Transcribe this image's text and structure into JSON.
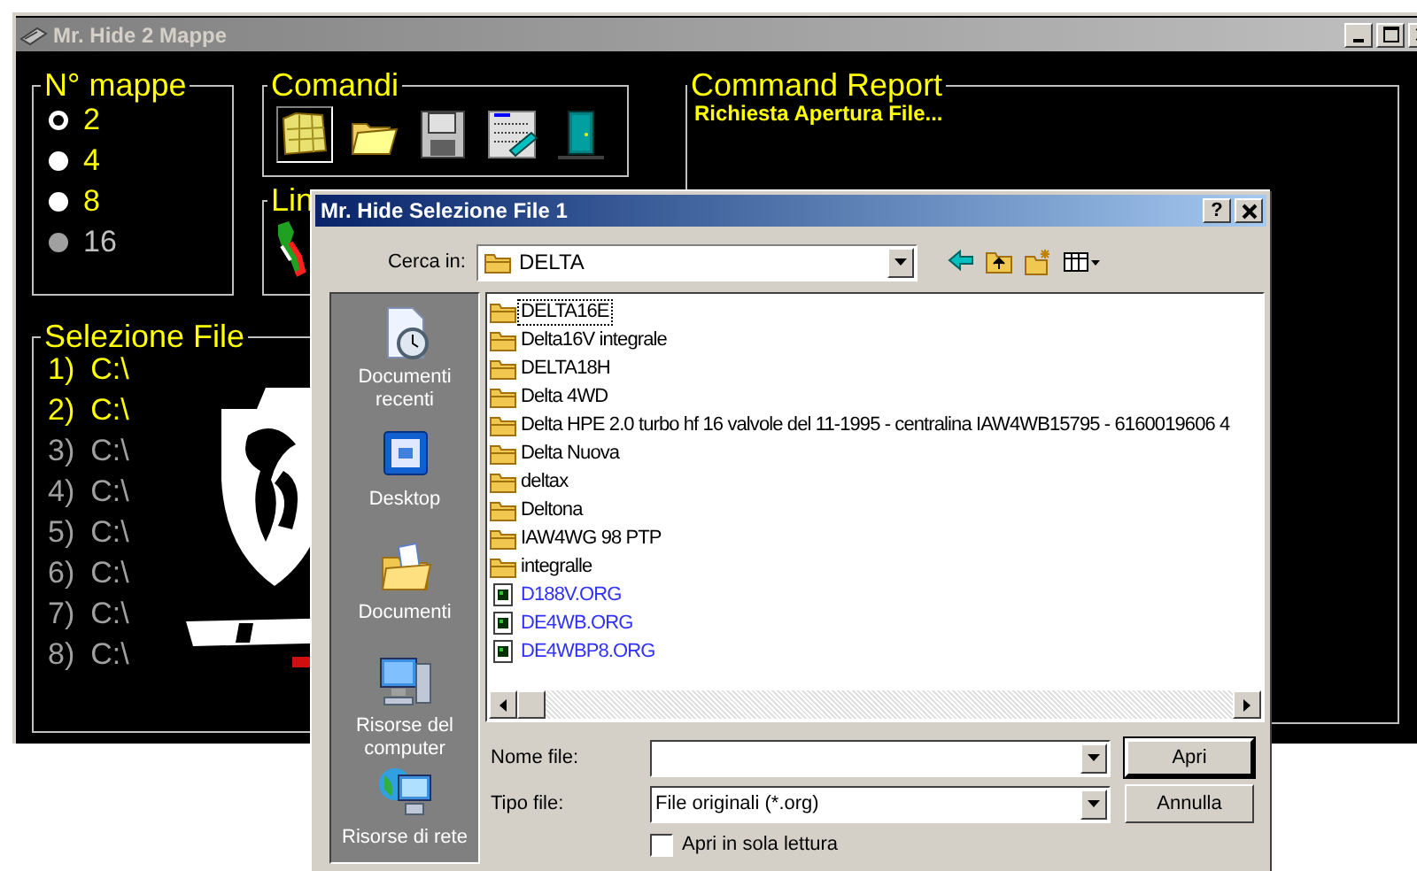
{
  "window": {
    "title": "Mr. Hide 2 Mappe",
    "active": false
  },
  "map_count": {
    "title": "N° mappe",
    "options": [
      {
        "label": "2",
        "selected": true,
        "disabled": false
      },
      {
        "label": "4",
        "selected": false,
        "disabled": false
      },
      {
        "label": "8",
        "selected": false,
        "disabled": false
      },
      {
        "label": "16",
        "selected": false,
        "disabled": true
      }
    ]
  },
  "commands": {
    "title": "Comandi",
    "buttons": [
      {
        "kind": "map",
        "pressed": true
      },
      {
        "kind": "open",
        "pressed": false
      },
      {
        "kind": "disk",
        "pressed": false
      },
      {
        "kind": "write",
        "pressed": false
      },
      {
        "kind": "exit",
        "pressed": false
      }
    ]
  },
  "lin_group": {
    "title": "Lin"
  },
  "command_report": {
    "title": "Command Report",
    "lines": [
      "Richiesta Apertura File..."
    ]
  },
  "file_selection": {
    "title": "Selezione File",
    "files": [
      {
        "number": "1)",
        "path": "C:\\",
        "enabled": true
      },
      {
        "number": "2)",
        "path": "C:\\",
        "enabled": true
      },
      {
        "number": "3)",
        "path": "C:\\",
        "enabled": false
      },
      {
        "number": "4)",
        "path": "C:\\",
        "enabled": false
      },
      {
        "number": "5)",
        "path": "C:\\",
        "enabled": false
      },
      {
        "number": "6)",
        "path": "C:\\",
        "enabled": false
      },
      {
        "number": "7)",
        "path": "C:\\",
        "enabled": false
      },
      {
        "number": "8)",
        "path": "C:\\",
        "enabled": false
      }
    ]
  },
  "dialog": {
    "title": "Mr. Hide Selezione File 1",
    "help_button": "?",
    "look_in": {
      "label": "Cerca in:",
      "value": "DELTA"
    },
    "places": [
      {
        "kind": "recent",
        "label": "Documenti recenti"
      },
      {
        "kind": "desktop",
        "label": "Desktop"
      },
      {
        "kind": "documents",
        "label": "Documenti"
      },
      {
        "kind": "computer",
        "label": "Risorse del computer"
      },
      {
        "kind": "network",
        "label": "Risorse di rete"
      }
    ],
    "files": [
      {
        "kind": "folder",
        "name": "DELTA16E",
        "focused": true
      },
      {
        "kind": "folder",
        "name": "Delta16V integrale",
        "focused": false
      },
      {
        "kind": "folder",
        "name": "DELTA18H",
        "focused": false
      },
      {
        "kind": "folder",
        "name": "Delta 4WD",
        "focused": false
      },
      {
        "kind": "folder",
        "name": "Delta HPE 2.0 turbo hf 16 valvole del 11-1995 - centralina IAW4WB15795 - 6160019606 4",
        "focused": false
      },
      {
        "kind": "folder",
        "name": "Delta Nuova",
        "focused": false
      },
      {
        "kind": "folder",
        "name": "deltax",
        "focused": false
      },
      {
        "kind": "folder",
        "name": "Deltona",
        "focused": false
      },
      {
        "kind": "folder",
        "name": "IAW4WG 98 PTP",
        "focused": false
      },
      {
        "kind": "folder",
        "name": "integralle",
        "focused": false
      },
      {
        "kind": "file",
        "name": "D188V.ORG",
        "focused": false
      },
      {
        "kind": "file",
        "name": "DE4WB.ORG",
        "focused": false
      },
      {
        "kind": "file",
        "name": "DE4WBP8.ORG",
        "focused": false
      }
    ],
    "file_name": {
      "label": "Nome file:"
    },
    "file_type": {
      "label": "Tipo file:",
      "value": "File originali (*.org)"
    },
    "read_only": {
      "label": "Apri in sola lettura",
      "checked": false
    },
    "buttons": [
      {
        "label": "Apri",
        "default": true
      },
      {
        "label": "Annulla",
        "default": false
      }
    ]
  }
}
